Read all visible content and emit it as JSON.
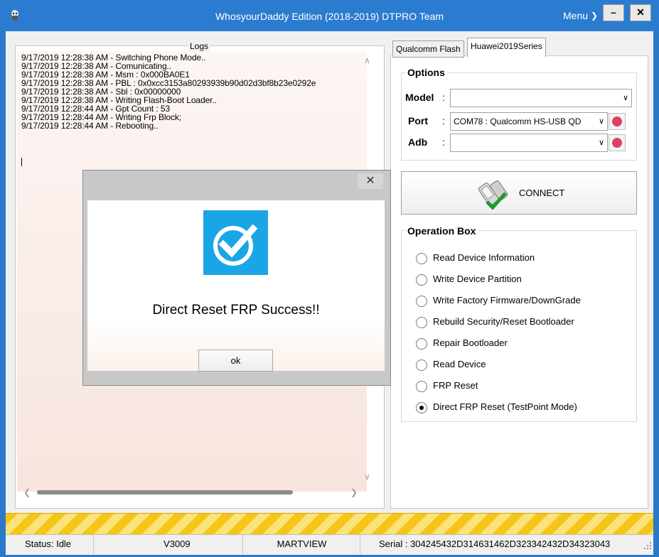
{
  "window": {
    "title": "WhosyourDaddy Edition (2018-2019) DTPRO Team",
    "menu_label": "Menu",
    "minimize_glyph": "–",
    "close_glyph": "✕"
  },
  "logs": {
    "legend": "Logs",
    "lines": [
      "9/17/2019 12:28:38 AM - Switching Phone Mode..",
      "9/17/2019 12:28:38 AM - Comunicating..",
      "9/17/2019 12:28:38 AM - Msm : 0x000BA0E1",
      "9/17/2019 12:28:38 AM - PBL : 0x0xcc3153a80293939b90d02d3bf8b23e0292e",
      "9/17/2019 12:28:38 AM - Sbl : 0x00000000",
      "9/17/2019 12:28:38 AM - Writing Flash-Boot Loader..",
      "9/17/2019 12:28:44 AM - Gpt Count : 53",
      "9/17/2019 12:28:44 AM - Writing Frp Block;",
      "9/17/2019 12:28:44 AM - Rebooting.."
    ]
  },
  "tabs": [
    {
      "label": "Qualcomm Flash",
      "active": false
    },
    {
      "label": "Huawei2019Series",
      "active": true
    }
  ],
  "options": {
    "legend": "Options",
    "model_label": "Model",
    "model_value": "",
    "port_label": "Port",
    "port_value": "COM78 : Qualcomm HS-USB QD",
    "adb_label": "Adb",
    "adb_value": "",
    "colon": ":"
  },
  "connect": {
    "label": "CONNECT"
  },
  "operation_box": {
    "legend": "Operation Box",
    "items": [
      {
        "label": "Read Device Information",
        "checked": false
      },
      {
        "label": "Write Device Partition",
        "checked": false
      },
      {
        "label": "Write Factory Firmware/DownGrade",
        "checked": false
      },
      {
        "label": "Rebuild Security/Reset Bootloader",
        "checked": false
      },
      {
        "label": "Repair Bootloader",
        "checked": false
      },
      {
        "label": "Read Device",
        "checked": false
      },
      {
        "label": "FRP Reset",
        "checked": false
      },
      {
        "label": "Direct FRP Reset (TestPoint Mode)",
        "checked": true
      }
    ]
  },
  "statusbar": {
    "status": "Status: Idle",
    "version": "V3009",
    "brand": "MARTVIEW",
    "serial": "Serial : 304245432D314631462D323342432D34323043"
  },
  "dialog": {
    "close_glyph": "✕",
    "message": "Direct Reset FRP Success!!",
    "ok_label": "ok",
    "icon_color": "#1aa6e6"
  },
  "colors": {
    "titlebar": "#2b7cd0",
    "progress": "#f5c518",
    "radio_accent": "#000000",
    "icon_red": "#e04060"
  }
}
